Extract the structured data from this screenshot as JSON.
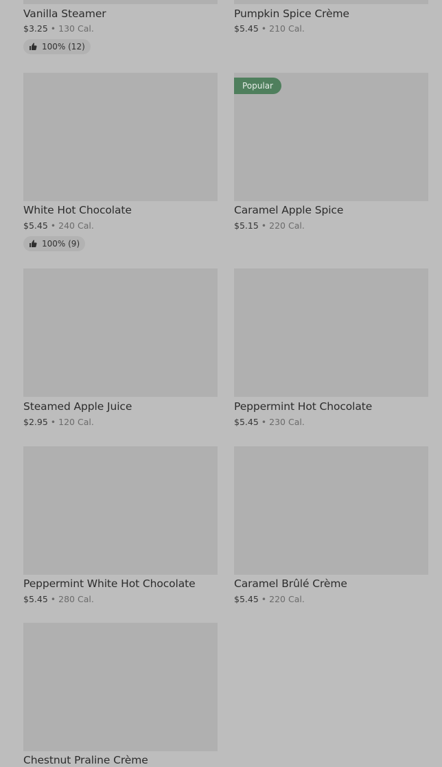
{
  "products": [
    {
      "name": "Vanilla Steamer",
      "price": "$3.25",
      "separator": "•",
      "calories": "130 Cal.",
      "rating": "100% (12)",
      "badge": null
    },
    {
      "name": "Pumpkin Spice Crème",
      "price": "$5.45",
      "separator": "•",
      "calories": "210 Cal.",
      "rating": null,
      "badge": null
    },
    {
      "name": "White Hot Chocolate",
      "price": "$5.45",
      "separator": "•",
      "calories": "240 Cal.",
      "rating": "100% (9)",
      "badge": null
    },
    {
      "name": "Caramel Apple Spice",
      "price": "$5.15",
      "separator": "•",
      "calories": "220 Cal.",
      "rating": null,
      "badge": "Popular"
    },
    {
      "name": "Steamed Apple Juice",
      "price": "$2.95",
      "separator": "•",
      "calories": "120 Cal.",
      "rating": null,
      "badge": null
    },
    {
      "name": "Peppermint Hot Chocolate",
      "price": "$5.45",
      "separator": "•",
      "calories": "230 Cal.",
      "rating": null,
      "badge": null
    },
    {
      "name": "Peppermint White Hot Chocolate",
      "price": "$5.45",
      "separator": "•",
      "calories": "280 Cal.",
      "rating": null,
      "badge": null
    },
    {
      "name": "Caramel Brûlé Crème",
      "price": "$5.45",
      "separator": "•",
      "calories": "220 Cal.",
      "rating": null,
      "badge": null
    },
    {
      "name": "Chestnut Praline Crème",
      "price": null,
      "separator": null,
      "calories": null,
      "rating": null,
      "badge": null
    }
  ],
  "icons": {
    "rating_icon": "thumbs-up-icon"
  },
  "colors": {
    "background": "#bdbdbd",
    "thumbnail_placeholder": "#b0b0b0",
    "badge": "#4f7f5d",
    "rating_pill": "#b2b2b2"
  }
}
